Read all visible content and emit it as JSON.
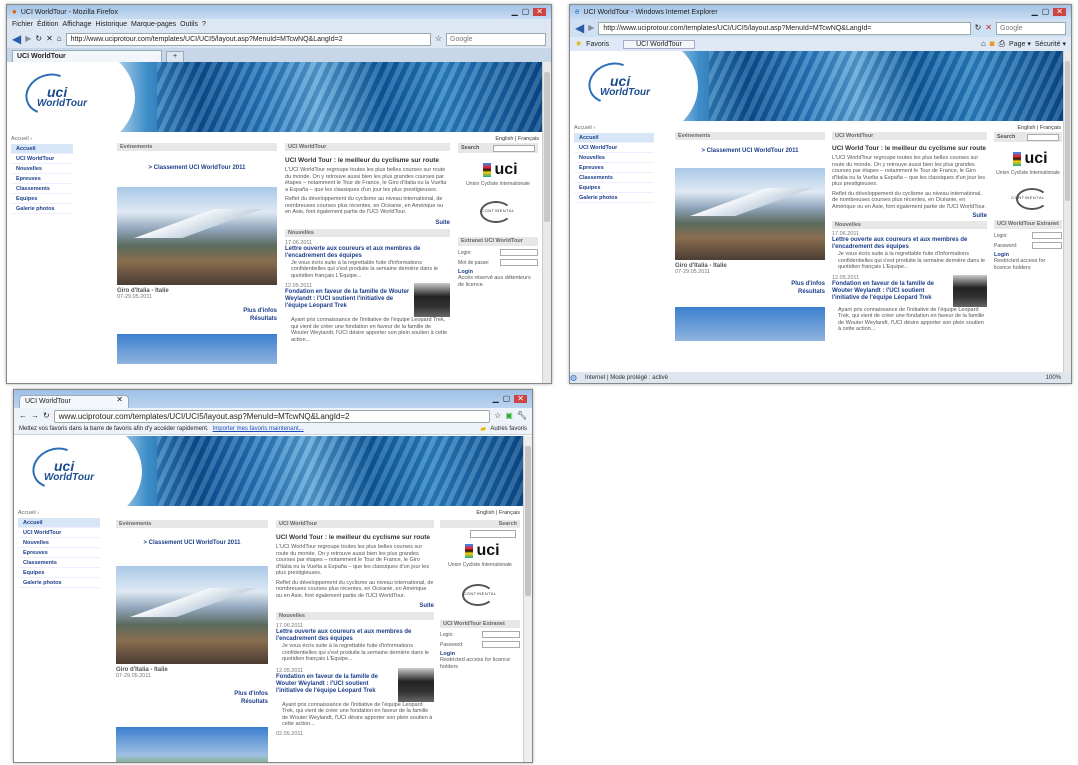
{
  "site": {
    "crumb": "Accueil ›",
    "lang": "English | Français",
    "logo_line1": "uci",
    "logo_line2": "WorldTour",
    "menu": [
      "Accueil",
      "UCI WorldTour",
      "Nouvelles",
      "Epreuves",
      "Classements",
      "Equipes",
      "Galerie photos"
    ],
    "events_header": "Evénements",
    "classement_link": "> Classement UCI WorldTour 2011",
    "photo_caption": "Giro d'Italia - Italie",
    "photo_date": "07-29.05.2011",
    "more_info": "Plus d'infos",
    "results": "Résultats",
    "wt_header": "UCI WorldTour",
    "wt_title": "UCI World Tour : le meilleur du cyclisme sur route",
    "wt_text1": "L'UCI WorldTour regroupe toutes les plus belles courses sur route du monde. On y retrouve aussi bien les plus grandes courses par étapes – notamment le Tour de France, le Giro d'Italia ou la Vuelta a España – que les classiques d'un jour les plus prestigieuses.",
    "wt_text2": "Reflet du développement du cyclisme au niveau international, de nombreuses courses plus récentes, en Océanie, en Amérique ou en Asie, font également partie de l'UCI WorldTour.",
    "suite": "Suite",
    "news_header": "Nouvelles",
    "news1_date": "17.06.2011",
    "news1_title": "Lettre ouverte aux coureurs et aux membres de l'encadrement des équipes",
    "news1_text": "Je vous écris suite à la regrettable fuite d'informations confidentielles qui s'est produite la semaine dernière dans le quotidien français L'Equipe...",
    "news2_date": "12.05.2011",
    "news2_title": "Fondation en faveur de la famille de Wouter Weylandt : l'UCI soutient l'initiative de l'équipe Léopard Trek",
    "news2_text": "Ayant pris connaissance de l'initiative de l'équipe Leopard Trek, qui vient de créer une fondation en faveur de la famille de Wouter Weylandt, l'UCI désire apporter son plein soutien à cette action...",
    "news3_date": "02.05.2011",
    "search": "Search",
    "uci_logo": "uci",
    "uci_name": "Union Cycliste Internationale",
    "continental": "CONTINENTAL",
    "extranet": "Extranet UCI WorldTour",
    "extranet_ie": "UCI WorldTour Extranet",
    "login_label": "Login:",
    "pwd_label_ff": "Mot de passe:",
    "pwd_label": "Password:",
    "login_btn": "Login",
    "access_ff": "Accès réservé aux détenteurs de licence",
    "access": "Restricted access for licence holders"
  },
  "firefox": {
    "title": "UCI WorldTour - Mozilla Firefox",
    "menu": [
      "Fichier",
      "Édition",
      "Affichage",
      "Historique",
      "Marque-pages",
      "Outils",
      "?"
    ],
    "url": "http://www.uciprotour.com/templates/UCI/UCI5/layout.asp?MenuId=MTcwNQ&LangId=2",
    "search": "Google",
    "tab": "UCI WorldTour",
    "newtab": "+"
  },
  "ie": {
    "title": "UCI WorldTour - Windows Internet Explorer",
    "url": "http://www.uciprotour.com/templates/UCI/UCI5/layout.asp?MenuId=MTcwNQ&LangId=",
    "search": "Google",
    "favoris": "Favoris",
    "tab": "UCI WorldTour",
    "page": "Page ▾",
    "securite": "Sécurité ▾",
    "status": "Internet | Mode protégé : activé",
    "zoom": "100%"
  },
  "chrome": {
    "tab": "UCI WorldTour",
    "url": "www.uciprotour.com/templates/UCI/UCI5/layout.asp?MenuId=MTcwNQ&LangId=2",
    "bookmarks_msg": "Mettez vos favoris dans la barre de favoris afin d'y accéder rapidement.",
    "import_link": "Importer mes favoris maintenant...",
    "other_bookmarks": "Autres favoris"
  }
}
